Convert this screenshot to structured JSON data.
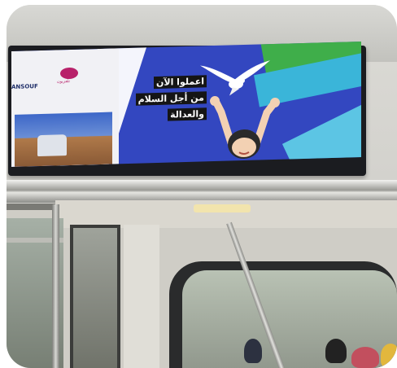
{
  "screen": {
    "headline_lines": [
      "اعملوا الآن",
      "من أجل السلام",
      "والعدالة"
    ],
    "logo_label": "تلفزيون",
    "site_label": "ANSOUF"
  },
  "colors": {
    "screen_blue": "#3347c0",
    "green_band": "#3fae4a",
    "cyan_band": "#3ab5d9",
    "logo_magenta": "#b8216a"
  }
}
